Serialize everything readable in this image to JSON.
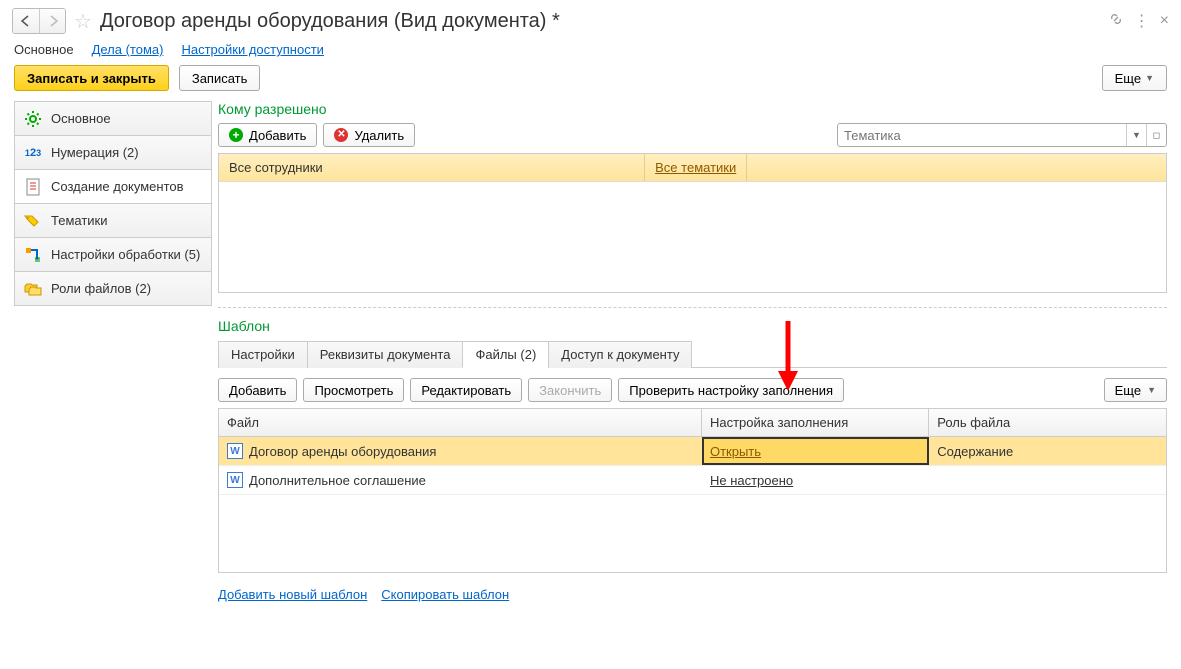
{
  "header": {
    "title": "Договор аренды оборудования (Вид документа) *"
  },
  "top_tabs": {
    "main": "Основное",
    "cases": "Дела (тома)",
    "access": "Настройки доступности"
  },
  "toolbar": {
    "save_close": "Записать и закрыть",
    "save": "Записать",
    "more": "Еще"
  },
  "sidebar": [
    {
      "label": "Основное",
      "kind": "main"
    },
    {
      "label": "Нумерация (2)",
      "kind": "numbering"
    },
    {
      "label": "Создание документов",
      "kind": "create"
    },
    {
      "label": "Тематики",
      "kind": "topics"
    },
    {
      "label": "Настройки обработки (5)",
      "kind": "processing"
    },
    {
      "label": "Роли файлов (2)",
      "kind": "roles"
    }
  ],
  "allowed": {
    "title": "Кому разрешено",
    "add": "Добавить",
    "delete": "Удалить",
    "topic_placeholder": "Тематика",
    "col1": "Все сотрудники",
    "col2": "Все тематики"
  },
  "template": {
    "title": "Шаблон",
    "tabs": {
      "settings": "Настройки",
      "attrs": "Реквизиты документа",
      "files": "Файлы (2)",
      "access": "Доступ к документу"
    },
    "buttons": {
      "add": "Добавить",
      "view": "Просмотреть",
      "edit": "Редактировать",
      "finish": "Закончить",
      "check": "Проверить настройку заполнения",
      "more": "Еще"
    },
    "columns": {
      "file": "Файл",
      "fill": "Настройка заполнения",
      "role": "Роль файла"
    },
    "rows": [
      {
        "file": "Договор аренды оборудования",
        "fill": "Открыть",
        "role": "Содержание"
      },
      {
        "file": "Дополнительное соглашение",
        "fill": "Не настроено",
        "role": ""
      }
    ]
  },
  "bottom": {
    "add_template": "Добавить новый шаблон",
    "copy_template": "Скопировать шаблон"
  },
  "icons": {
    "w": "W"
  }
}
